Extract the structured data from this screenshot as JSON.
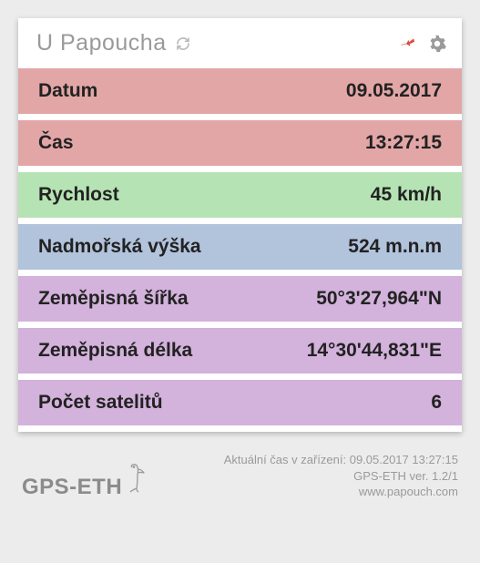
{
  "header": {
    "title": "U Papoucha"
  },
  "rows": {
    "date": {
      "label": "Datum",
      "value": "09.05.2017"
    },
    "time": {
      "label": "Čas",
      "value": "13:27:15"
    },
    "speed": {
      "label": "Rychlost",
      "value": "45 km/h"
    },
    "altitude": {
      "label": "Nadmořská výška",
      "value": "524 m.n.m"
    },
    "latitude": {
      "label": "Zeměpisná šířka",
      "value": "50°3'27,964\"N"
    },
    "longitude": {
      "label": "Zeměpisná délka",
      "value": "14°30'44,831\"E"
    },
    "satellites": {
      "label": "Počet satelitů",
      "value": "6"
    }
  },
  "footer": {
    "logo_text": "GPS-ETH",
    "device_time_line": "Aktuální čas v zařízení: 09.05.2017 13:27:15",
    "version_line": "GPS-ETH ver. 1.2/1",
    "url_line": "www.papouch.com"
  }
}
